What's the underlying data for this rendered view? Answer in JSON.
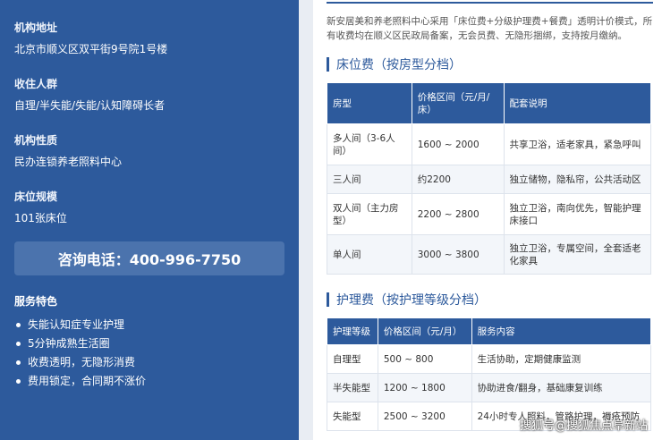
{
  "sidebar": {
    "address_label": "机构地址",
    "address_value": "北京市顺义区双平街9号院1号楼",
    "residents_label": "收住人群",
    "residents_value": "自理/半失能/失能/认知障碍长者",
    "nature_label": "机构性质",
    "nature_value": "民办连锁养老照料中心",
    "beds_label": "床位规模",
    "beds_value": "101张床位",
    "phone": "咨询电话：400-996-7750",
    "features_title": "服务特色",
    "features": [
      "失能认知症专业护理",
      "5分钟成熟生活圈",
      "收费透明，无隐形消费",
      "费用锁定，合同期不涨价"
    ]
  },
  "content": {
    "intro": "新安居美和养老照料中心采用「床位费+分级护理费+餐费」透明计价模式，所有收费均在顺义区民政局备案，无会员费、无隐形捆绑，支持按月缴纳。",
    "bed_section_title": "床位费（按房型分档）",
    "bed_table": {
      "headers": [
        "房型",
        "价格区间（元/月/床）",
        "配套说明"
      ],
      "rows": [
        [
          "多人间（3-6人间）",
          "1600 ~ 2000",
          "共享卫浴，适老家具，紧急呼叫"
        ],
        [
          "三人间",
          "约2200",
          "独立储物，隐私帘，公共活动区"
        ],
        [
          "双人间（主力房型）",
          "2200 ~ 2800",
          "独立卫浴，南向优先，智能护理床接口"
        ],
        [
          "单人间",
          "3000 ~ 3800",
          "独立卫浴，专属空间，全套适老化家具"
        ]
      ]
    },
    "care_section_title": "护理费（按护理等级分档）",
    "care_table": {
      "headers": [
        "护理等级",
        "价格区间（元/月）",
        "服务内容"
      ],
      "rows": [
        [
          "自理型",
          "500 ~ 800",
          "生活协助，定期健康监测"
        ],
        [
          "半失能型",
          "1200 ~ 1800",
          "协助进食/翻身，基础康复训练"
        ],
        [
          "失能型",
          "2500 ~ 3200",
          "24小时专人照料，管路护理，褥疮预防"
        ]
      ]
    }
  },
  "watermark": "搜狐号@搜狐焦点阜新站"
}
